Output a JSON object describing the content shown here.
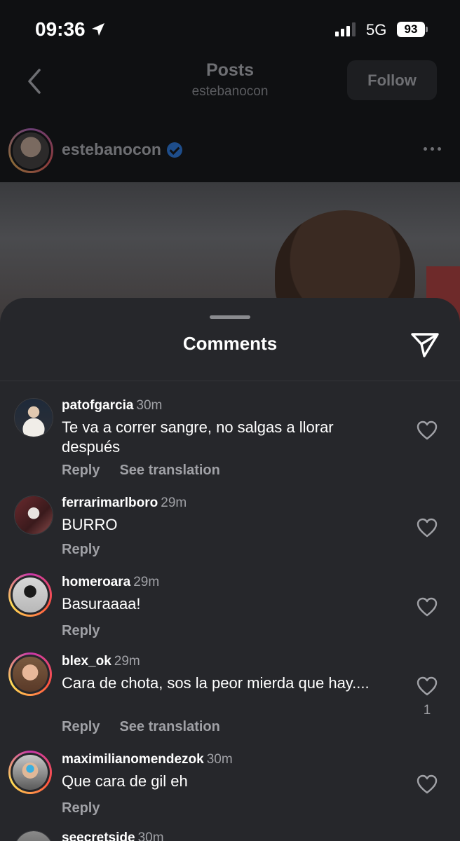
{
  "status_bar": {
    "time": "09:36",
    "network": "5G",
    "battery": "93"
  },
  "header": {
    "title": "Posts",
    "subtitle": "estebanocon",
    "follow_label": "Follow"
  },
  "post": {
    "username": "estebanocon"
  },
  "comments_sheet": {
    "title": "Comments",
    "comments": [
      {
        "username": "patofgarcia",
        "time": "30m",
        "text": "Te va a correr sangre, no salgas a llorar después",
        "reply": "Reply",
        "translation": "See translation",
        "likes": ""
      },
      {
        "username": "ferrarimarlboro",
        "time": "29m",
        "text": "BURRO",
        "reply": "Reply",
        "translation": "",
        "likes": ""
      },
      {
        "username": "homeroara",
        "time": "29m",
        "text": "Basuraaaa!",
        "reply": "Reply",
        "translation": "",
        "likes": ""
      },
      {
        "username": "blex_ok",
        "time": "29m",
        "text": "Cara de chota, sos la peor mierda que hay....",
        "reply": "Reply",
        "translation": "See translation",
        "likes": "1"
      },
      {
        "username": "maximilianomendezok",
        "time": "30m",
        "text": "Que cara de gil eh",
        "reply": "Reply",
        "translation": "",
        "likes": ""
      },
      {
        "username": "seecretside",
        "time": "30m"
      }
    ]
  },
  "icons": {
    "location": "location-arrow-icon",
    "back": "chevron-left-icon",
    "verified": "verified-badge-icon",
    "more": "more-horizontal-icon",
    "send": "send-icon",
    "like": "heart-icon"
  },
  "colors": {
    "background": "#0f1012",
    "sheet": "#26272b",
    "muted_text": "#a0a1a6",
    "verified": "#1e4d8a"
  }
}
